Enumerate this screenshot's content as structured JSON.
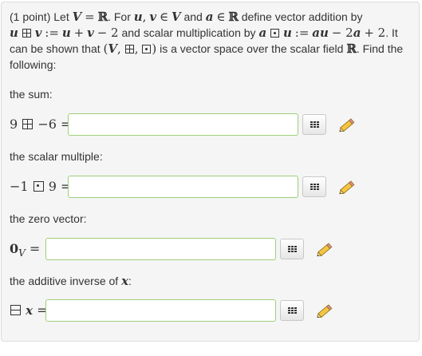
{
  "intro": {
    "points": "(1 point) Let",
    "for_text": ". For",
    "and_text": "and",
    "define_text": "define vector addition by",
    "scalar_text": "and scalar multiplication by",
    "it_text": ". It can be shown that",
    "vs_text": "is a vector space over the scalar field",
    "find_text": ". Find the following:"
  },
  "parts": [
    {
      "label": "the sum:",
      "expr_left": "9",
      "expr_right": "−6 ="
    },
    {
      "label": "the scalar multiple:",
      "expr_left": "−1",
      "expr_right": "9 ="
    },
    {
      "label": "the zero vector:",
      "expr": "0",
      "sub": "V",
      "eq": "="
    },
    {
      "label": "the additive inverse of",
      "label_var": "x",
      "label_end": ":",
      "expr": "x",
      "eq": "="
    }
  ],
  "icons": {
    "keyboard": "keyboard-grid-icon",
    "pencil": "pencil-icon"
  },
  "colors": {
    "input_border": "#9fce7a",
    "panel_bg": "#f5f5f5"
  }
}
